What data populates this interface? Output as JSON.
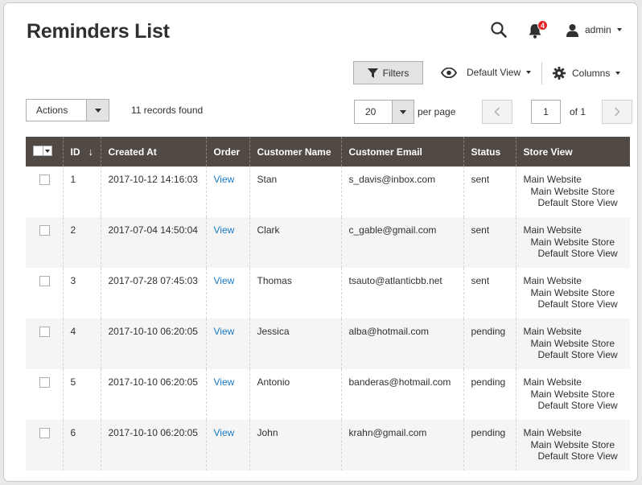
{
  "header": {
    "title": "Reminders List",
    "notifications_count": "4",
    "user_name": "admin"
  },
  "toolbar": {
    "filters_label": "Filters",
    "view_label": "Default View",
    "columns_label": "Columns",
    "actions_label": "Actions",
    "records_found": "11 records found",
    "per_page_value": "20",
    "per_page_label": "per page",
    "page_current": "1",
    "page_total_label": "of 1"
  },
  "table": {
    "columns": [
      "ID",
      "Created At",
      "Order",
      "Customer Name",
      "Customer Email",
      "Status",
      "Store View"
    ],
    "rows": [
      {
        "id": "1",
        "created_at": "2017-10-12 14:16:03",
        "order": "View",
        "customer_name": "Stan",
        "customer_email": "s_davis@inbox.com",
        "status": "sent",
        "store_view": [
          "Main Website",
          "Main Website Store",
          "Default Store View"
        ]
      },
      {
        "id": "2",
        "created_at": "2017-07-04 14:50:04",
        "order": "View",
        "customer_name": "Clark",
        "customer_email": "c_gable@gmail.com",
        "status": "sent",
        "store_view": [
          "Main Website",
          "Main Website Store",
          "Default Store View"
        ]
      },
      {
        "id": "3",
        "created_at": "2017-07-28 07:45:03",
        "order": "View",
        "customer_name": "Thomas",
        "customer_email": "tsauto@atlanticbb.net",
        "status": "sent",
        "store_view": [
          "Main Website",
          "Main Website Store",
          "Default Store View"
        ]
      },
      {
        "id": "4",
        "created_at": "2017-10-10 06:20:05",
        "order": "View",
        "customer_name": "Jessica",
        "customer_email": "alba@hotmail.com",
        "status": "pending",
        "store_view": [
          "Main Website",
          "Main Website Store",
          "Default Store View"
        ]
      },
      {
        "id": "5",
        "created_at": "2017-10-10 06:20:05",
        "order": "View",
        "customer_name": "Antonio",
        "customer_email": "banderas@hotmail.com",
        "status": "pending",
        "store_view": [
          "Main Website",
          "Main Website Store",
          "Default Store View"
        ]
      },
      {
        "id": "6",
        "created_at": "2017-10-10 06:20:05",
        "order": "View",
        "customer_name": "John",
        "customer_email": "krahn@gmail.com",
        "status": "pending",
        "store_view": [
          "Main Website",
          "Main Website Store",
          "Default Store View"
        ]
      }
    ]
  },
  "icons": {
    "search": "search-icon",
    "notifications": "bell-icon",
    "user": "user-icon",
    "filter": "filter-icon",
    "view": "eye-icon",
    "columns": "gear-icon",
    "prev": "chevron-left-icon",
    "next": "chevron-right-icon"
  },
  "colors": {
    "header_bg": "#514943",
    "link": "#1979c3",
    "badge": "#e22626"
  }
}
